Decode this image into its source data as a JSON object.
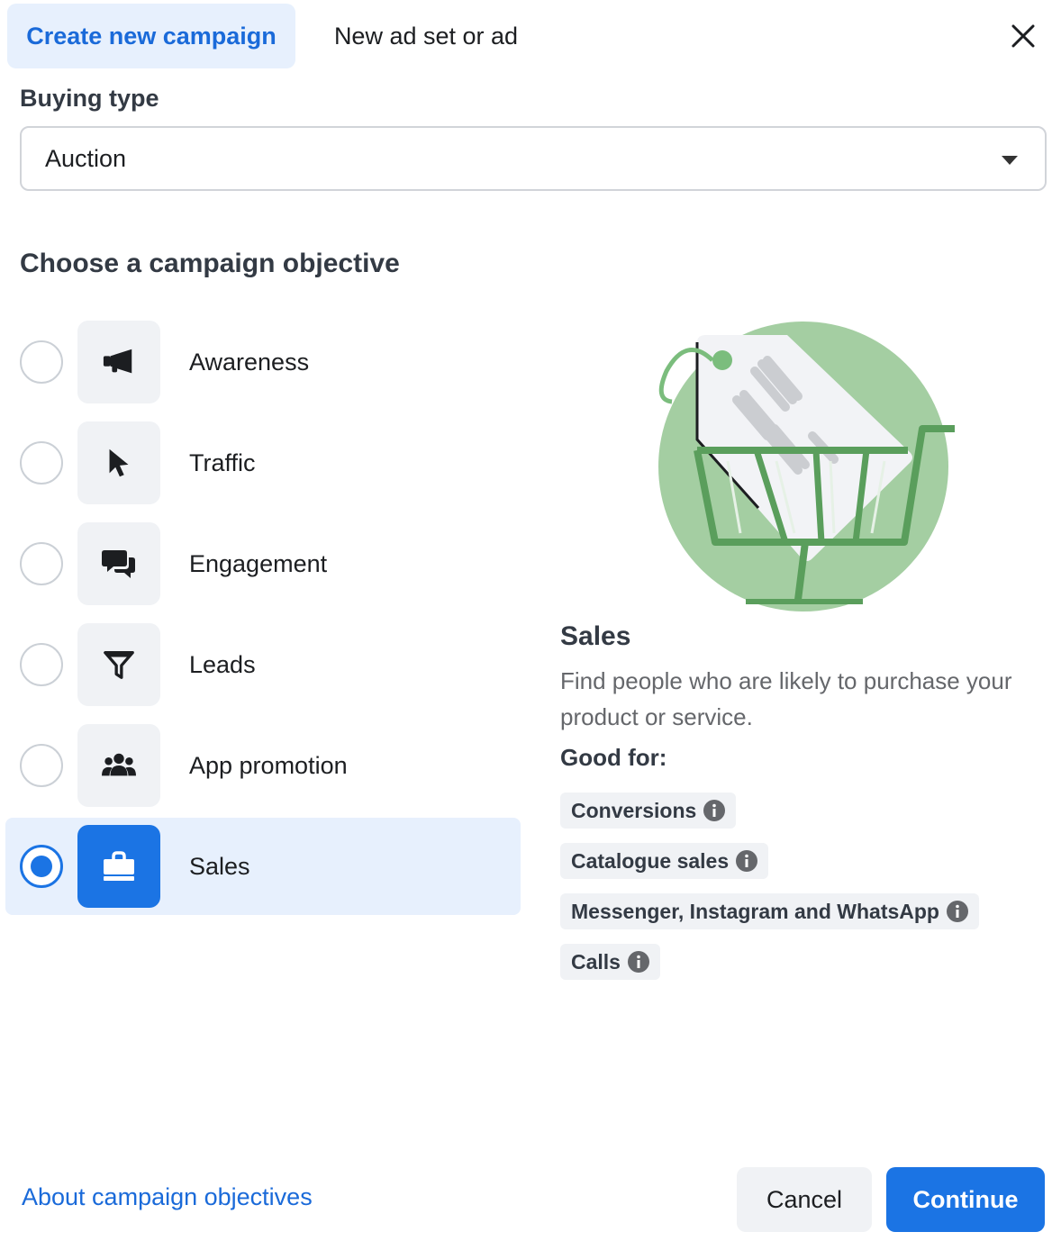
{
  "header": {
    "tab_create": "Create new campaign",
    "tab_existing": "New ad set or ad",
    "close_icon": "close-icon"
  },
  "buying_type": {
    "label": "Buying type",
    "selected": "Auction"
  },
  "objectives": {
    "heading": "Choose a campaign objective",
    "items": [
      {
        "label": "Awareness",
        "icon": "megaphone-icon",
        "selected": false
      },
      {
        "label": "Traffic",
        "icon": "cursor-icon",
        "selected": false
      },
      {
        "label": "Engagement",
        "icon": "chat-bubbles-icon",
        "selected": false
      },
      {
        "label": "Leads",
        "icon": "funnel-icon",
        "selected": false
      },
      {
        "label": "App promotion",
        "icon": "people-icon",
        "selected": false
      },
      {
        "label": "Sales",
        "icon": "shopping-bag-icon",
        "selected": true
      }
    ]
  },
  "detail": {
    "title": "Sales",
    "description": "Find people who are likely to purchase your product or service.",
    "good_for_label": "Good for:",
    "chips": [
      "Conversions",
      "Catalogue sales",
      "Messenger, Instagram and WhatsApp",
      "Calls"
    ]
  },
  "footer": {
    "about_link": "About campaign objectives",
    "cancel": "Cancel",
    "continue": "Continue"
  },
  "colors": {
    "accent": "#1b74e4",
    "link": "#1a6ad9",
    "selected_bg": "#e7f0fd",
    "illustration_green": "#a4cea2"
  }
}
